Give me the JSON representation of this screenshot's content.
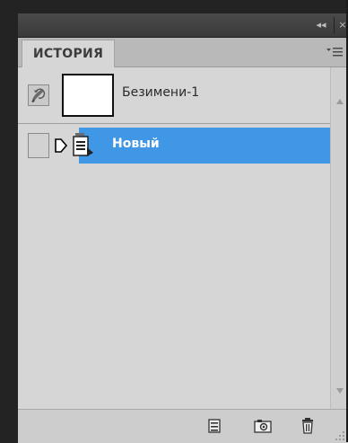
{
  "dock": {
    "collapse_label": "◂◂",
    "close_label": "×"
  },
  "tab": {
    "label": "ИСТОРИЯ"
  },
  "snapshot": {
    "name": "Безимени-1"
  },
  "states": [
    {
      "label": "Новый",
      "selected": true
    }
  ],
  "colors": {
    "selection": "#3f97e6",
    "panel": "#d6d6d6"
  },
  "icons": {
    "snapshot_brush": "history-brush-icon",
    "state_marker": "history-state-marker-icon",
    "new_document": "document-icon",
    "new_document_from_state": "new-document-from-state-icon",
    "create_snapshot": "camera-icon",
    "delete_state": "trash-icon",
    "panel_menu": "panel-menu-icon"
  }
}
